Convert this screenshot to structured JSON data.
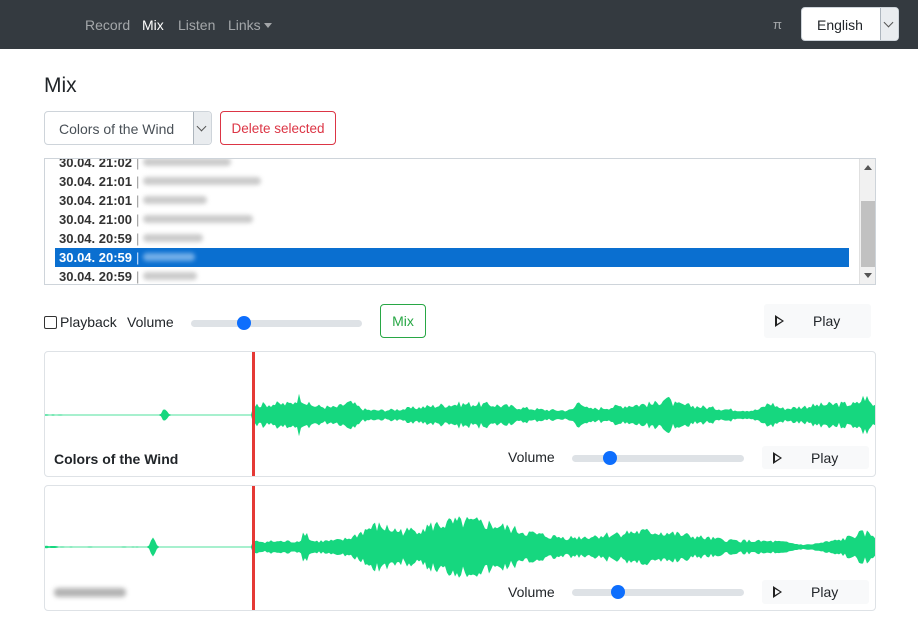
{
  "nav": {
    "items": [
      {
        "label": "Record",
        "active": false
      },
      {
        "label": "Mix",
        "active": true
      },
      {
        "label": "Listen",
        "active": false
      },
      {
        "label": "Links",
        "active": false,
        "dropdown": true
      }
    ],
    "pi_label": "π",
    "language": {
      "selected": "English"
    }
  },
  "page": {
    "title": "Mix"
  },
  "controls": {
    "song_select": {
      "selected": "Colors of the Wind"
    },
    "delete_label": "Delete selected"
  },
  "recordings": [
    {
      "timestamp": "30.04. 21:02",
      "name_redacted": true,
      "selected": false
    },
    {
      "timestamp": "30.04. 21:01",
      "name_redacted": true,
      "selected": false
    },
    {
      "timestamp": "30.04. 21:01",
      "name_redacted": true,
      "selected": false
    },
    {
      "timestamp": "30.04. 21:00",
      "name_redacted": true,
      "selected": false
    },
    {
      "timestamp": "30.04. 20:59",
      "name_redacted": true,
      "selected": false
    },
    {
      "timestamp": "30.04. 20:59",
      "name_redacted": true,
      "selected": true
    },
    {
      "timestamp": "30.04. 20:59",
      "name_redacted": true,
      "selected": false
    }
  ],
  "recording_separator": "|",
  "mix_bar": {
    "playback_label": "Playback",
    "playback_checked": false,
    "volume_label": "Volume",
    "volume_level": 0.31,
    "mix_label": "Mix",
    "play_label": "Play"
  },
  "tracks": [
    {
      "name": "Colors of the Wind",
      "name_redacted": false,
      "volume_label": "Volume",
      "volume_level": 0.22,
      "play_label": "Play",
      "playhead_fraction": 0.25
    },
    {
      "name": "",
      "name_redacted": true,
      "volume_label": "Volume",
      "volume_level": 0.27,
      "play_label": "Play",
      "playhead_fraction": 0.25
    }
  ],
  "colors": {
    "navbar": "#343a40",
    "waveform": "#16d77f",
    "playhead": "#e53935",
    "selected_row": "#0a6fd0",
    "danger": "#dc3545",
    "success": "#28a745",
    "slider_thumb": "#0d6efd"
  }
}
